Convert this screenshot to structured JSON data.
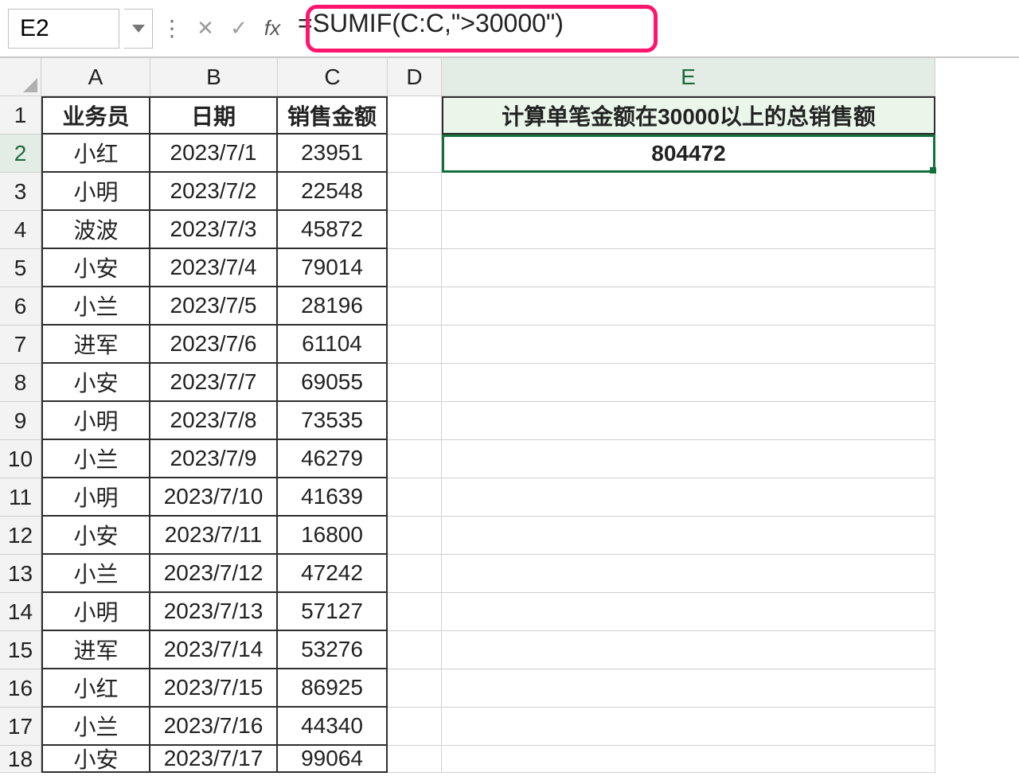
{
  "namebox": {
    "value": "E2"
  },
  "formula_bar": {
    "formula": "=SUMIF(C:C,\">30000\")"
  },
  "column_letters": [
    "A",
    "B",
    "C",
    "D",
    "E"
  ],
  "row_numbers": [
    "1",
    "2",
    "3",
    "4",
    "5",
    "6",
    "7",
    "8",
    "9",
    "10",
    "11",
    "12",
    "13",
    "14",
    "15",
    "16",
    "17",
    "18"
  ],
  "table": {
    "headers": {
      "A": "业务员",
      "B": "日期",
      "C": "销售金额"
    },
    "rows": [
      {
        "A": "小红",
        "B": "2023/7/1",
        "C": "23951"
      },
      {
        "A": "小明",
        "B": "2023/7/2",
        "C": "22548"
      },
      {
        "A": "波波",
        "B": "2023/7/3",
        "C": "45872"
      },
      {
        "A": "小安",
        "B": "2023/7/4",
        "C": "79014"
      },
      {
        "A": "小兰",
        "B": "2023/7/5",
        "C": "28196"
      },
      {
        "A": "进军",
        "B": "2023/7/6",
        "C": "61104"
      },
      {
        "A": "小安",
        "B": "2023/7/7",
        "C": "69055"
      },
      {
        "A": "小明",
        "B": "2023/7/8",
        "C": "73535"
      },
      {
        "A": "小兰",
        "B": "2023/7/9",
        "C": "46279"
      },
      {
        "A": "小明",
        "B": "2023/7/10",
        "C": "41639"
      },
      {
        "A": "小安",
        "B": "2023/7/11",
        "C": "16800"
      },
      {
        "A": "小兰",
        "B": "2023/7/12",
        "C": "47242"
      },
      {
        "A": "小明",
        "B": "2023/7/13",
        "C": "57127"
      },
      {
        "A": "进军",
        "B": "2023/7/14",
        "C": "53276"
      },
      {
        "A": "小红",
        "B": "2023/7/15",
        "C": "86925"
      },
      {
        "A": "小兰",
        "B": "2023/7/16",
        "C": "44340"
      },
      {
        "A": "小安",
        "B": "2023/7/17",
        "C": "99064"
      }
    ]
  },
  "result_block": {
    "title": "计算单笔金额在30000以上的总销售额",
    "value": "804472"
  },
  "selected_cell": "E2"
}
